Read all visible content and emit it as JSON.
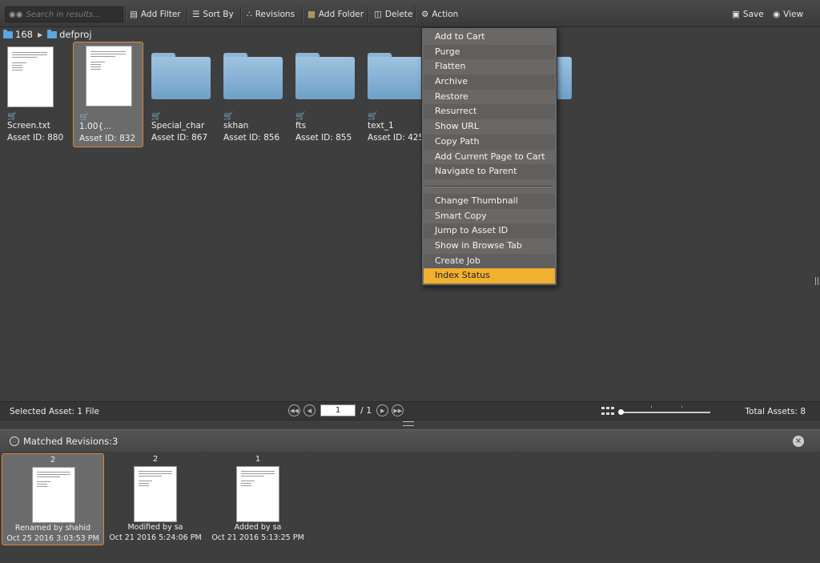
{
  "toolbar": {
    "search_placeholder": "Search in results...",
    "add_filter": "Add Filter",
    "sort_by": "Sort By",
    "revisions": "Revisions",
    "add_folder": "Add Folder",
    "delete": "Delete",
    "action": "Action",
    "save": "Save",
    "view": "View"
  },
  "breadcrumb": {
    "items": [
      "168",
      "defproj"
    ]
  },
  "assets": [
    {
      "name": "Screen.txt",
      "id": "Asset ID: 880",
      "type": "document"
    },
    {
      "name": "1.00{...",
      "id": "Asset ID: 832",
      "type": "document"
    },
    {
      "name": "Special_char",
      "id": "Asset ID: 867",
      "type": "folder"
    },
    {
      "name": "skhan",
      "id": "Asset ID: 856",
      "type": "folder"
    },
    {
      "name": "fts",
      "id": "Asset ID: 855",
      "type": "folder"
    },
    {
      "name": "text_1",
      "id": "Asset ID: 425",
      "type": "folder"
    }
  ],
  "context_menu": {
    "items": [
      "Add to Cart",
      "Purge",
      "Flatten",
      "Archive",
      "Restore",
      "Resurrect",
      "Show URL",
      "Copy Path",
      "Add Current Page to Cart",
      "Navigate to Parent",
      "Change Thumbnail",
      "Smart Copy",
      "Jump to Asset ID",
      "Show in Browse Tab",
      "Create Job",
      "Index Status"
    ],
    "highlighted": "Index Status",
    "highlight_color": "#f0b030"
  },
  "status_bar": {
    "selected": "Selected Asset: 1 File",
    "page_current": "1",
    "page_total": "/ 1",
    "total_assets": "Total Assets: 8"
  },
  "revisions_panel": {
    "title": "Matched Revisions:3",
    "items": [
      {
        "number": "2",
        "by": "Renamed by shahid",
        "date": "Oct 25 2016 3:03:53 PM"
      },
      {
        "number": "2",
        "by": "Modified by sa",
        "date": "Oct 21 2016 5:24:06 PM"
      },
      {
        "number": "1",
        "by": "Added by sa",
        "date": "Oct 21 2016 5:13:25 PM"
      }
    ]
  },
  "colors": {
    "selection_border": "#d8883a",
    "folder_blue": "#5aa7e0",
    "cart_orange": "#e07a1a"
  }
}
